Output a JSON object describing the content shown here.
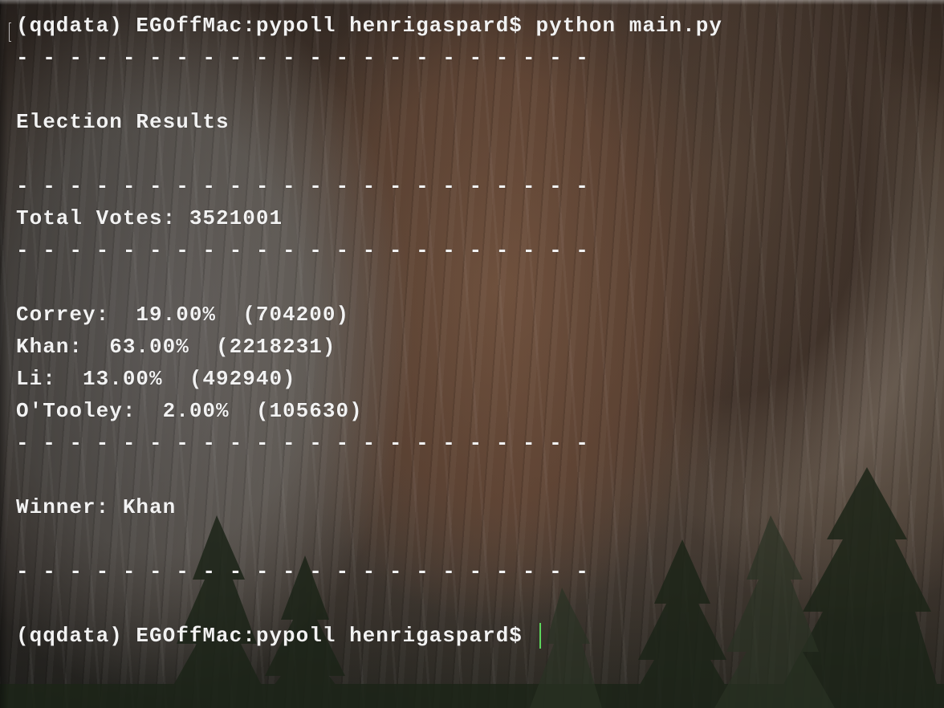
{
  "terminal": {
    "command_line": "(qqdata) EGOffMac:pypoll henrigaspard$ python main.py",
    "separator": "- - - - - - - - - - - - - - - - - - - - - -",
    "heading": "Election Results",
    "total_votes": "Total Votes: 3521001",
    "results": [
      {
        "text": "Correy:  19.00%  (704200)"
      },
      {
        "text": "Khan:  63.00%  (2218231)"
      },
      {
        "text": "Li:  13.00%  (492940)"
      },
      {
        "text": "O'Tooley:  2.00%  (105630)"
      }
    ],
    "winner": "Winner: Khan",
    "prompt": "(qqdata) EGOffMac:pypoll henrigaspard$ "
  },
  "colors": {
    "text": "#f2f2f2",
    "cursor": "#5cd65c"
  }
}
